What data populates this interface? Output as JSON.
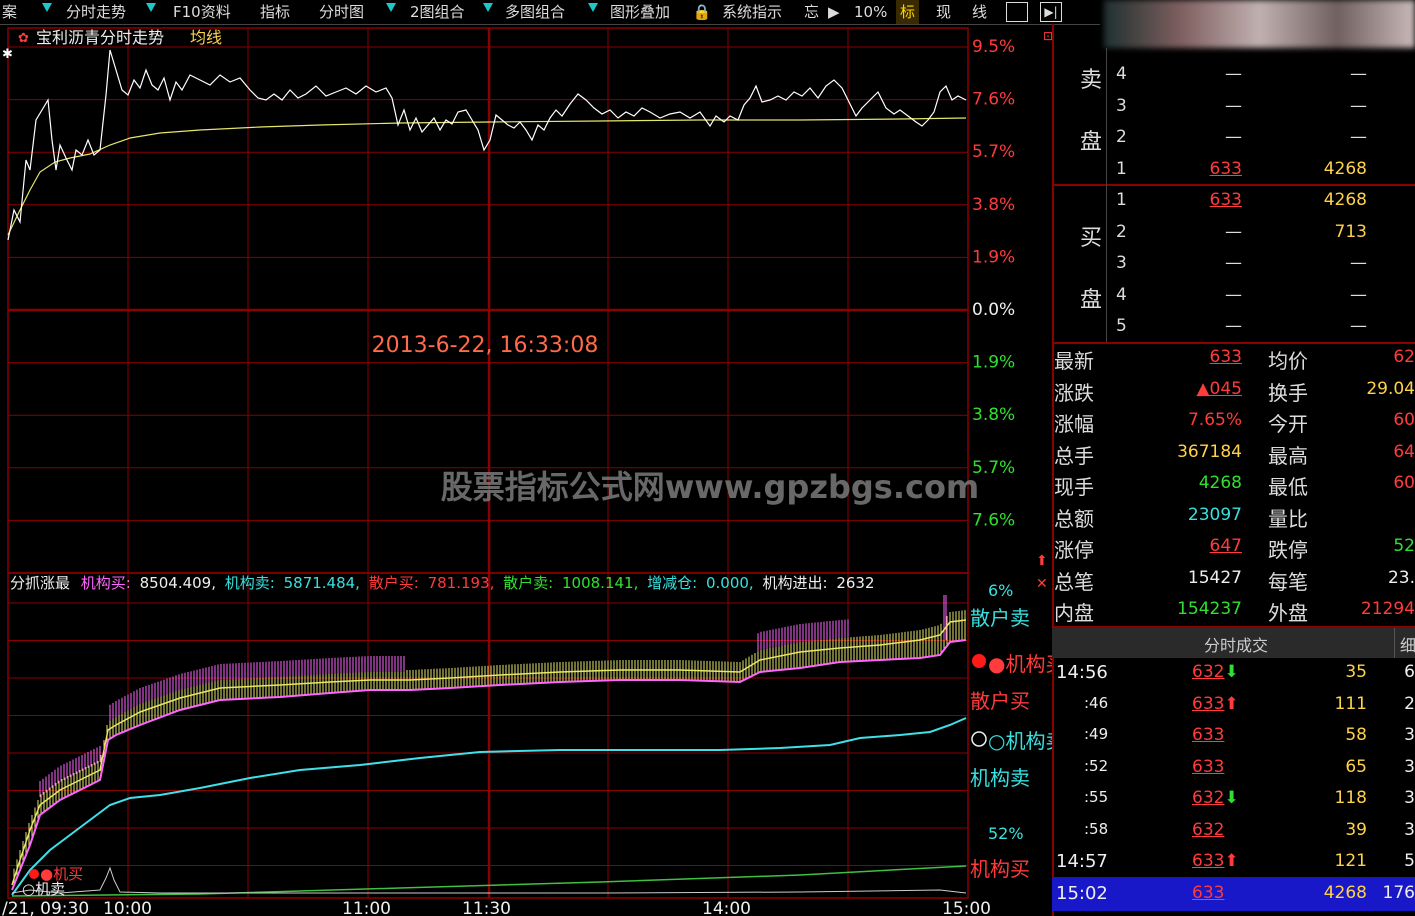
{
  "toolbar": {
    "items": [
      "案",
      "分时走势",
      "F10资料",
      "指标",
      "分时图",
      "2图组合",
      "多图组合",
      "图形叠加",
      "系统指示",
      "忘",
      "10%",
      "标",
      "现",
      "线"
    ]
  },
  "chart_header": {
    "title": "宝利沥青分时走势",
    "avg_label": "均线"
  },
  "timestamp_overlay": "2013-6-22, 16:33:08",
  "watermark": "股票指标公式网www.gpzbgs.com",
  "price_axis_labels": [
    "9.5%",
    "7.6%",
    "5.7%",
    "3.8%",
    "1.9%",
    "0.0%",
    "1.9%",
    "3.8%",
    "5.7%",
    "7.6%"
  ],
  "indicator": {
    "name": "分抓涨最",
    "items": [
      {
        "label": "机构买:",
        "value": "8504.409,"
      },
      {
        "label": "机构卖:",
        "value": "5871.484,"
      },
      {
        "label": "散户买:",
        "value": "781.193,"
      },
      {
        "label": "散户卖:",
        "value": "1008.141,"
      },
      {
        "label": "增减仓:",
        "value": "0.000,"
      },
      {
        "label": "机构进出:",
        "value": "2632"
      }
    ],
    "right_labels": {
      "top_pct": "6%",
      "retail_sell": "散户卖",
      "inst_buy_marker": "●机构买",
      "retail_buy": "散户买",
      "inst_sell_marker": "○机构卖",
      "inst_sell": "机构卖",
      "bottom_pct": "52%",
      "inst_buy": "机构买"
    },
    "legend_buy": "●机买",
    "legend_sell": "○机卖"
  },
  "time_axis": [
    "/21, 09:30",
    "10:00",
    "11:00",
    "11:30",
    "14:00",
    "15:00"
  ],
  "order_book": {
    "sell_label_1": "卖",
    "sell_label_2": "盘",
    "buy_label_1": "买",
    "buy_label_2": "盘",
    "sell": [
      {
        "level": "4",
        "price": "—",
        "vol": "—"
      },
      {
        "level": "3",
        "price": "—",
        "vol": "—"
      },
      {
        "level": "2",
        "price": "—",
        "vol": "—"
      },
      {
        "level": "1",
        "price": "633",
        "vol": "4268"
      }
    ],
    "buy": [
      {
        "level": "1",
        "price": "633",
        "vol": "4268"
      },
      {
        "level": "2",
        "price": "—",
        "vol": "713"
      },
      {
        "level": "3",
        "price": "—",
        "vol": "—"
      },
      {
        "level": "4",
        "price": "—",
        "vol": "—"
      },
      {
        "level": "5",
        "price": "—",
        "vol": "—"
      }
    ]
  },
  "quote": {
    "left": [
      {
        "label": "最新",
        "value": "633"
      },
      {
        "label": "涨跌",
        "value": "▲045"
      },
      {
        "label": "涨幅",
        "value": "7.65%"
      },
      {
        "label": "总手",
        "value": "367184"
      },
      {
        "label": "现手",
        "value": "4268"
      },
      {
        "label": "总额",
        "value": "23097"
      },
      {
        "label": "涨停",
        "value": "647"
      },
      {
        "label": "总笔",
        "value": "15427"
      },
      {
        "label": "内盘",
        "value": "154237"
      }
    ],
    "right": [
      {
        "label": "均价",
        "value": "62"
      },
      {
        "label": "换手",
        "value": "29.04"
      },
      {
        "label": "今开",
        "value": "60"
      },
      {
        "label": "最高",
        "value": "64"
      },
      {
        "label": "最低",
        "value": "60"
      },
      {
        "label": "量比",
        "value": ""
      },
      {
        "label": "跌停",
        "value": "52"
      },
      {
        "label": "每笔",
        "value": "23."
      },
      {
        "label": "外盘",
        "value": "21294"
      }
    ]
  },
  "ticks": {
    "header": "分时成交",
    "header_right": "细",
    "rows": [
      {
        "time": "14:56",
        "price": "632",
        "arrow": "down",
        "vol": "35",
        "n": "6"
      },
      {
        "time": ":46",
        "price": "633",
        "arrow": "up",
        "vol": "111",
        "n": "2"
      },
      {
        "time": ":49",
        "price": "633",
        "arrow": "",
        "vol": "58",
        "n": "3"
      },
      {
        "time": ":52",
        "price": "633",
        "arrow": "",
        "vol": "65",
        "n": "3"
      },
      {
        "time": ":55",
        "price": "632",
        "arrow": "down",
        "vol": "118",
        "n": "3"
      },
      {
        "time": ":58",
        "price": "632",
        "arrow": "",
        "vol": "39",
        "n": "3"
      },
      {
        "time": "14:57",
        "price": "633",
        "arrow": "up",
        "vol": "121",
        "n": "5"
      },
      {
        "time": "15:02",
        "price": "633",
        "arrow": "",
        "vol": "4268",
        "n": "176"
      }
    ]
  },
  "colors": {
    "grid": "#8b0000",
    "price_line": "#ffffff",
    "avg_line": "#e6e66a",
    "inst_buy": "#ff66ff",
    "retail": "#e6e66a",
    "inst_sell": "#40e0e8",
    "low_line": "#40c040",
    "highlight_row": "#1818c8"
  }
}
